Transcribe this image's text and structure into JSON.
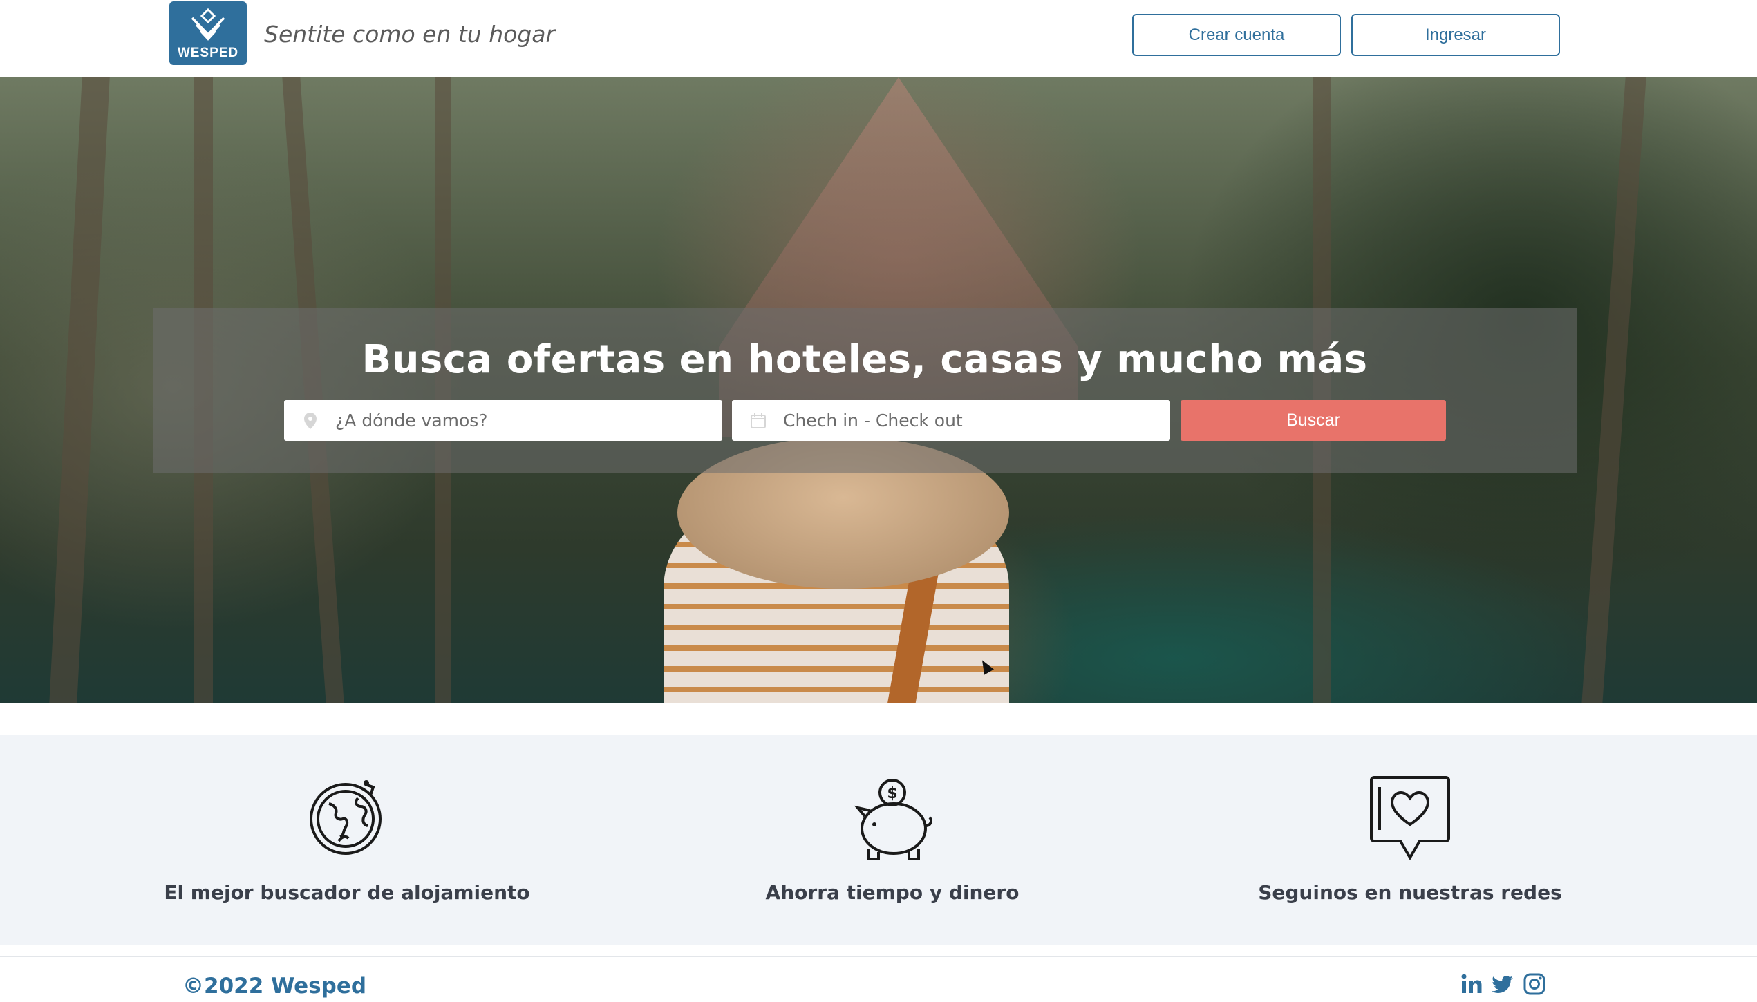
{
  "header": {
    "logo_text": "WESPED",
    "tagline": "Sentite como en tu hogar",
    "create_account_label": "Crear cuenta",
    "login_label": "Ingresar"
  },
  "search": {
    "title": "Busca ofertas en hoteles, casas y mucho más",
    "destination_placeholder": "¿A dónde vamos?",
    "dates_placeholder": "Chech in - Check out",
    "search_label": "Buscar"
  },
  "features": [
    {
      "icon": "globe-icon",
      "label": "El mejor buscador de alojamiento"
    },
    {
      "icon": "piggy-bank-icon",
      "label": "Ahorra tiempo y dinero"
    },
    {
      "icon": "heart-chat-icon",
      "label": "Seguinos en nuestras redes"
    }
  ],
  "footer": {
    "copyright": "©2022 Wesped",
    "social": [
      "linkedin-icon",
      "twitter-icon",
      "instagram-icon"
    ]
  },
  "colors": {
    "brand": "#2f6f9c",
    "accent": "#e8736a",
    "features_bg": "#f1f4f8"
  }
}
